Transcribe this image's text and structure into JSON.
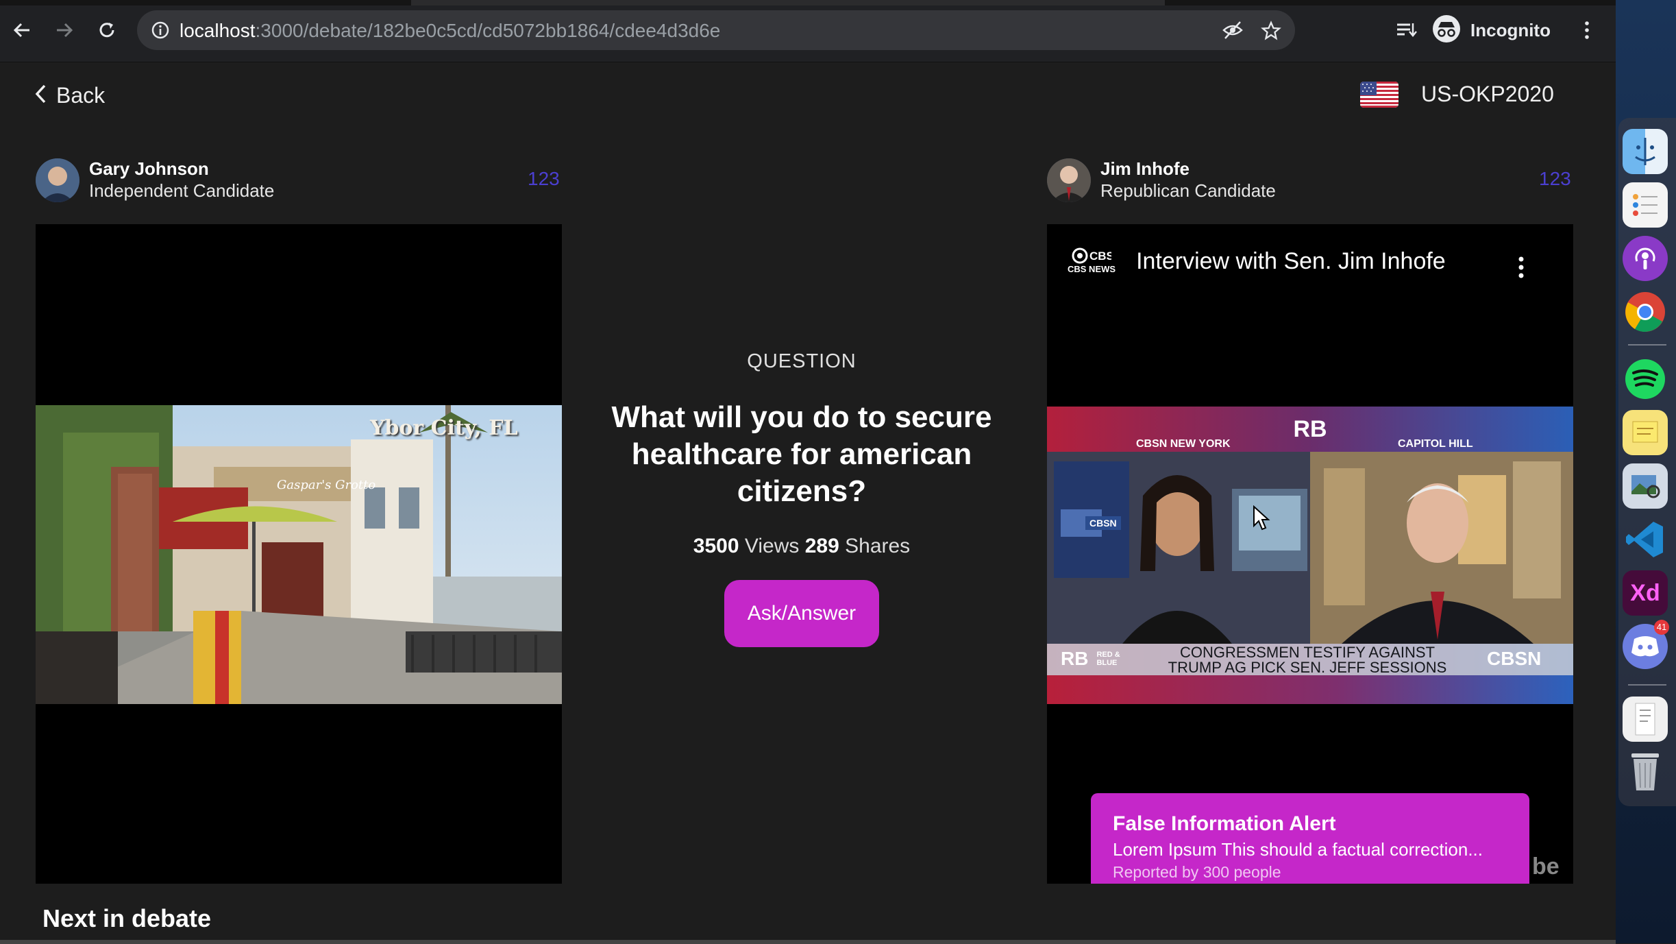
{
  "browser": {
    "url_host": "localhost",
    "url_path": ":3000/debate/182be0c5cd/cd5072bb1864/cdee4d3d6e",
    "profile_label": "Incognito"
  },
  "header": {
    "back_label": "Back",
    "election_id": "US-OKP2020"
  },
  "candidates": [
    {
      "name": "Gary Johnson",
      "party": "Independent Candidate",
      "count": "123"
    },
    {
      "name": "Jim Inhofe",
      "party": "Republican Candidate",
      "count": "123"
    }
  ],
  "left_video": {
    "overlay_text": "Ybor City, FL",
    "sign_text": "Gaspar's Grotto"
  },
  "right_video": {
    "channel": "CBS NEWS",
    "title": "Interview with Sen. Jim Inhofe",
    "brand": "RB",
    "left_location": "CBSN NEW YORK",
    "right_location": "CAPITOL HILL",
    "lower_third_line1": "CONGRESSMEN TESTIFY AGAINST",
    "lower_third_line2": "TRUMP AG PICK SEN. JEFF SESSIONS",
    "lower_third_left": "RB",
    "lower_third_sub": "RED & BLUE",
    "lower_third_right": "CBSN",
    "desk_logo": "CBSN"
  },
  "question": {
    "label": "QUESTION",
    "text": "What will you do to secure healthcare for american citizens?",
    "views": "3500",
    "views_label": "Views",
    "shares": "289",
    "shares_label": "Shares",
    "button_label": "Ask/Answer"
  },
  "alert": {
    "title": "False Information Alert",
    "body": "Lorem Ipsum This should a factual correction...",
    "meta": "Reported by 300 people"
  },
  "next_heading": "Next in debate",
  "dock": {
    "xd_label": "Xd",
    "discord_badge": "41"
  },
  "colors": {
    "accent": "#c527c9",
    "count": "#4b3fd0",
    "background": "#1d1d1d"
  }
}
